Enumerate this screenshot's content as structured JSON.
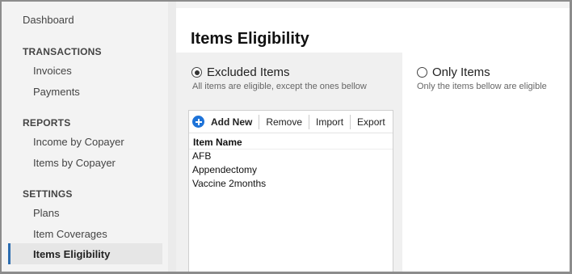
{
  "sidebar": {
    "dashboard": "Dashboard",
    "sections": [
      {
        "title": "TRANSACTIONS",
        "items": [
          "Invoices",
          "Payments"
        ]
      },
      {
        "title": "REPORTS",
        "items": [
          "Income by Copayer",
          "Items by Copayer"
        ]
      },
      {
        "title": "SETTINGS",
        "items": [
          "Plans",
          "Item Coverages",
          "Items Eligibility"
        ]
      }
    ],
    "active_item": "Items Eligibility"
  },
  "main": {
    "title": "Items Eligibility",
    "options": [
      {
        "label": "Excluded Items",
        "description": "All items are eligible, except the ones bellow",
        "selected": true
      },
      {
        "label": "Only Items",
        "description": "Only the items bellow are eligible",
        "selected": false
      }
    ],
    "toolbar": {
      "add_new": "Add New",
      "remove": "Remove",
      "import": "Import",
      "export": "Export"
    },
    "table": {
      "column": "Item Name",
      "rows": [
        "AFB",
        "Appendectomy",
        "Vaccine 2months"
      ]
    }
  },
  "colors": {
    "accent": "#2b6cb0",
    "add_icon": "#1e73d8",
    "sidebar_bg": "#f3f3f3",
    "panel_bg": "#f0f0f0"
  }
}
